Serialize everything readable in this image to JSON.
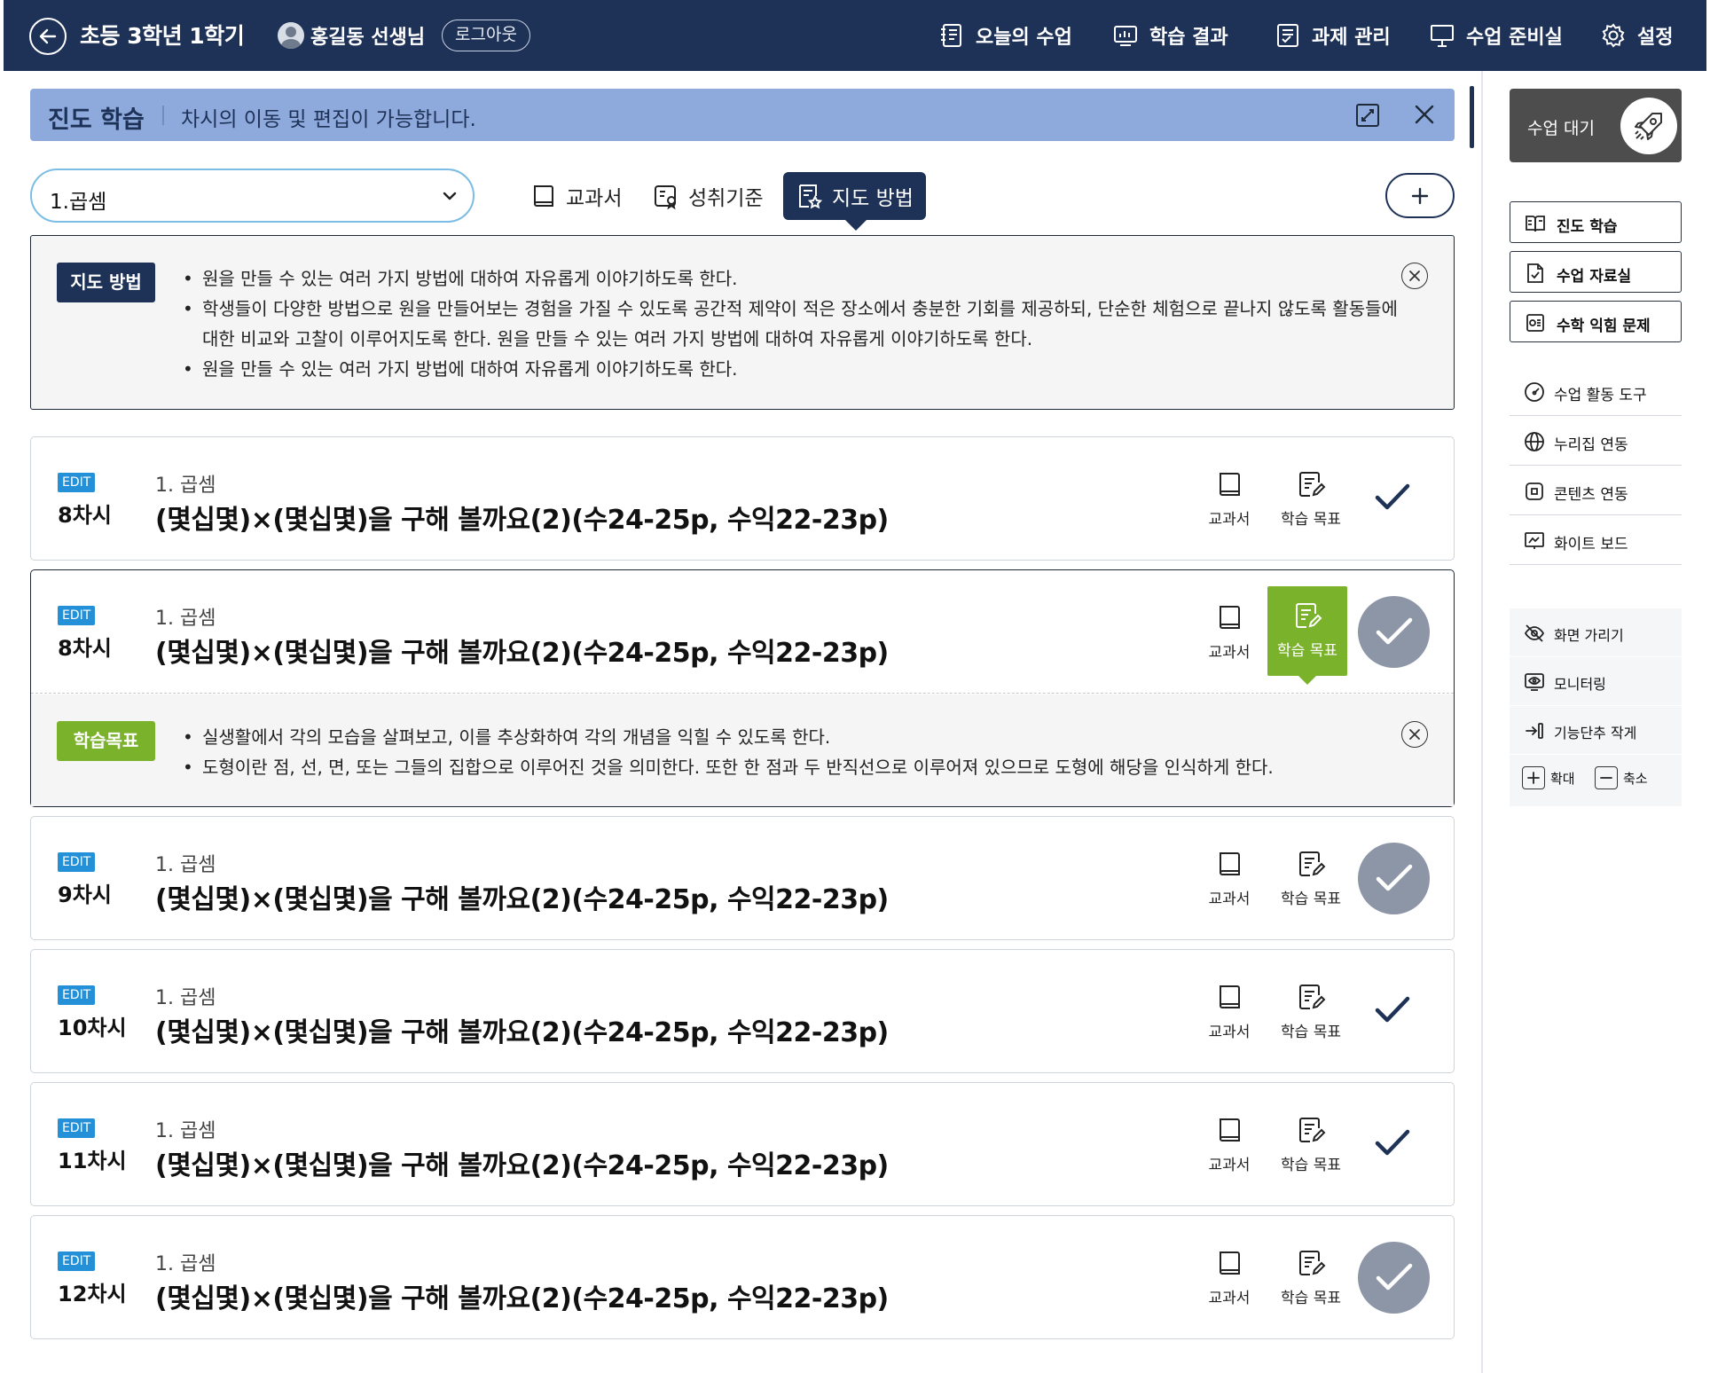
{
  "header": {
    "title": "초등 3학년 1학기",
    "user_name": "홍길동 선생님",
    "logout_label": "로그아웃",
    "nav": [
      {
        "label": "오늘의 수업",
        "icon": "notebook-icon"
      },
      {
        "label": "학습 결과",
        "icon": "chart-report-icon"
      },
      {
        "label": "과제 관리",
        "icon": "assignment-icon"
      },
      {
        "label": "수업 준비실",
        "icon": "board-icon"
      },
      {
        "label": "설정",
        "icon": "gear-icon"
      }
    ]
  },
  "panel": {
    "title": "진도 학습",
    "subtitle": "차시의 이동 및 편집이 가능합니다."
  },
  "toolbar": {
    "unit_value": "1.곱셈",
    "tabs": [
      {
        "label": "교과서",
        "icon": "textbook-icon",
        "active": false
      },
      {
        "label": "성취기준",
        "icon": "achievement-icon",
        "active": false
      },
      {
        "label": "지도 방법",
        "icon": "guide-method-icon",
        "active": true
      }
    ]
  },
  "guide": {
    "tag": "지도 방법",
    "bullets": [
      "원을 만들 수 있는 여러 가지 방법에 대하여 자유롭게 이야기하도록 한다.",
      "학생들이 다양한 방법으로 원을 만들어보는 경험을 가질 수 있도록 공간적 제약이 적은 장소에서 충분한 기회를 제공하되, 단순한 체험으로 끝나지 않도록 활동들에 대한 비교와 고찰이 이루어지도록 한다. 원을 만들 수 있는 여러 가지 방법에 대하여 자유롭게 이야기하도록 한다.",
      "원을 만들 수 있는 여러 가지 방법에 대하여 자유롭게 이야기하도록 한다."
    ]
  },
  "lessons": [
    {
      "badge": "EDIT",
      "session": "8차시",
      "chapter": "1. 곱셈",
      "title": "(몇십몇)×(몇십몇)을 구해 볼까요(2)(수24-25p, 수익22-23p)",
      "textbook_label": "교과서",
      "goal_label": "학습 목표",
      "status": "check"
    },
    {
      "badge": "EDIT",
      "session": "8차시",
      "chapter": "1. 곱셈",
      "title": "(몇십몇)×(몇십몇)을 구해 볼까요(2)(수24-25p, 수익22-23p)",
      "textbook_label": "교과서",
      "goal_label": "학습 목표",
      "status": "done"
    },
    {
      "badge": "EDIT",
      "session": "9차시",
      "chapter": "1. 곱셈",
      "title": "(몇십몇)×(몇십몇)을 구해 볼까요(2)(수24-25p, 수익22-23p)",
      "textbook_label": "교과서",
      "goal_label": "학습 목표",
      "status": "done"
    },
    {
      "badge": "EDIT",
      "session": "10차시",
      "chapter": "1. 곱셈",
      "title": "(몇십몇)×(몇십몇)을 구해 볼까요(2)(수24-25p, 수익22-23p)",
      "textbook_label": "교과서",
      "goal_label": "학습 목표",
      "status": "check"
    },
    {
      "badge": "EDIT",
      "session": "11차시",
      "chapter": "1. 곱셈",
      "title": "(몇십몇)×(몇십몇)을 구해 볼까요(2)(수24-25p, 수익22-23p)",
      "textbook_label": "교과서",
      "goal_label": "학습 목표",
      "status": "check"
    },
    {
      "badge": "EDIT",
      "session": "12차시",
      "chapter": "1. 곱셈",
      "title": "(몇십몇)×(몇십몇)을 구해 볼까요(2)(수24-25p, 수익22-23p)",
      "textbook_label": "교과서",
      "goal_label": "학습 목표",
      "status": "done"
    }
  ],
  "learning_goal": {
    "tag": "학습목표",
    "bullets": [
      "실생활에서 각의 모습을 살펴보고, 이를 추상화하여 각의 개념을 익힐 수 있도록 한다.",
      "도형이란 점, 선, 면, 또는 그들의 집합으로 이루어진 것을 의미한다. 또한 한 점과 두 반직선으로 이루어져 있으므로 도형에 해당을 인식하게 한다."
    ]
  },
  "sidebar": {
    "class_wait_label": "수업 대기",
    "buttons": [
      "진도 학습",
      "수업 자료실",
      "수학 익힘 문제"
    ],
    "tools": [
      "수업 활동 도구",
      "누리집 연동",
      "콘텐츠 연동",
      "화이트 보드"
    ],
    "panel_items": [
      "화면 가리기",
      "모니터링",
      "기능단추 작게"
    ],
    "zoom_in_label": "확대",
    "zoom_out_label": "축소"
  },
  "colors": {
    "header_bg": "#1e3257",
    "panel_header_bg": "#8eaadc",
    "edit_badge": "#2490d8",
    "goal_green": "#7bb22b",
    "done_circle": "#8d96a6"
  }
}
